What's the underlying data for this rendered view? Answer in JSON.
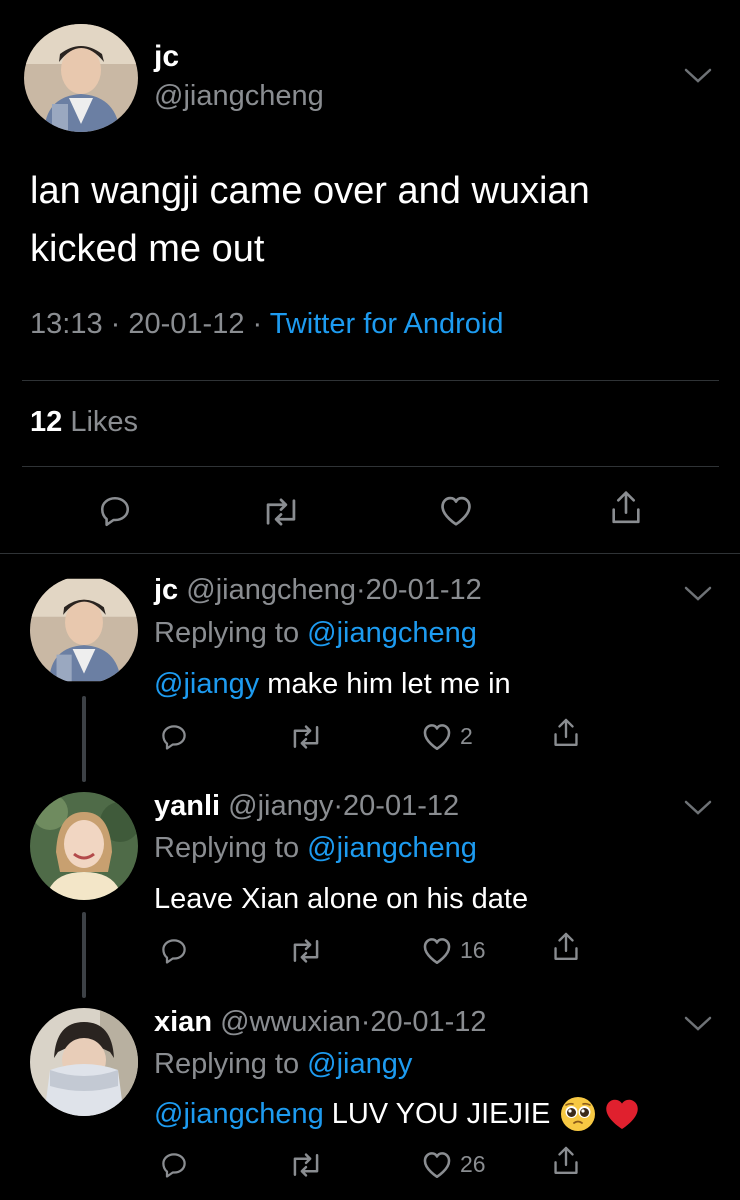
{
  "main_tweet": {
    "display_name": "jc",
    "handle": "@jiangcheng",
    "text_line1": "lan wangji came over and wuxian",
    "text_line2": "kicked me out",
    "time": "13:13",
    "sep1": "·",
    "date": "20-01-12",
    "sep2": "·",
    "source": "Twitter for Android",
    "likes_count": "12",
    "likes_label": "Likes"
  },
  "replies": [
    {
      "display_name": "jc",
      "handle": "@jiangcheng",
      "sep": "·",
      "date": "20-01-12",
      "replying_prefix": "Replying to",
      "replying_to": "@jiangcheng",
      "mention": "@jiangy",
      "text": "make him let me in",
      "likes": "2"
    },
    {
      "display_name": "yanli",
      "handle": "@jiangy",
      "sep": "·",
      "date": "20-01-12",
      "replying_prefix": "Replying to",
      "replying_to": "@jiangcheng",
      "text": "Leave Xian alone on his date",
      "likes": "16"
    },
    {
      "display_name": "xian",
      "handle": "@wwuxian",
      "sep": "·",
      "date": "20-01-12",
      "replying_prefix": "Replying to",
      "replying_to": "@jiangy",
      "mention": "@jiangcheng",
      "text": "LUV YOU JIEJIE",
      "emojis": [
        "pleading-face",
        "red-heart"
      ],
      "likes": "26"
    }
  ],
  "colors": {
    "background": "#000000",
    "text": "#ffffff",
    "muted": "#8a8d91",
    "link": "#1d9bf0",
    "divider": "#2f3336",
    "heart": "#e0202e"
  }
}
